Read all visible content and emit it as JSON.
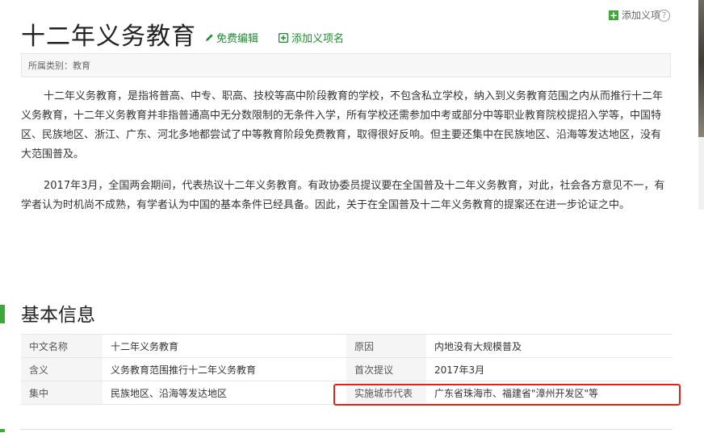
{
  "header": {
    "title": "十二年义务教育",
    "edit_label": "免费编辑",
    "add_name_label": "添加义项名",
    "add_item_label": "添加义项",
    "help_symbol": "?"
  },
  "category": {
    "text": "所属类别：教育"
  },
  "paragraphs": [
    "十二年义务教育，是指将普高、中专、职高、技校等高中阶段教育的学校，不包含私立学校，纳入到义务教育范围之内从而推行十二年义务教育，十二年义务教育并非指普通高中无分数限制的无条件入学，所有学校还需参加中考或部分中等职业教育院校提招入学等，中国特区、民族地区、浙江、广东、河北多地都尝试了中等教育阶段免费教育，取得很好反响。但主要还集中在民族地区、沿海等发达地区，没有大范围普及。",
    "2017年3月，全国两会期间，代表热议十二年义务教育。有政协委员提议要在全国普及十二年义务教育，对此，社会各方意见不一，有学者认为时机尚不成熟，有学者认为中国的基本条件已经具备。因此，关于在全国普及十二年义务教育的提案还在进一步论证之中。"
  ],
  "basic_info": {
    "title": "基本信息",
    "rows": [
      {
        "k1": "中文名称",
        "v1": "十二年义务教育",
        "k2": "原因",
        "v2": "内地没有大规模普及"
      },
      {
        "k1": "含义",
        "v1": "义务教育范围推行十二年义务教育",
        "k2": "首次提议",
        "v2": "2017年3月"
      },
      {
        "k1": "集中",
        "v1": "民族地区、沿海等发达地区",
        "k2": "实施城市代表",
        "v2": "广东省珠海市、福建省\"漳州开发区\"等"
      }
    ]
  },
  "colors": {
    "accent_green": "#3fa73a",
    "link_green": "#1b8b2d",
    "highlight_red": "#d9251c"
  }
}
